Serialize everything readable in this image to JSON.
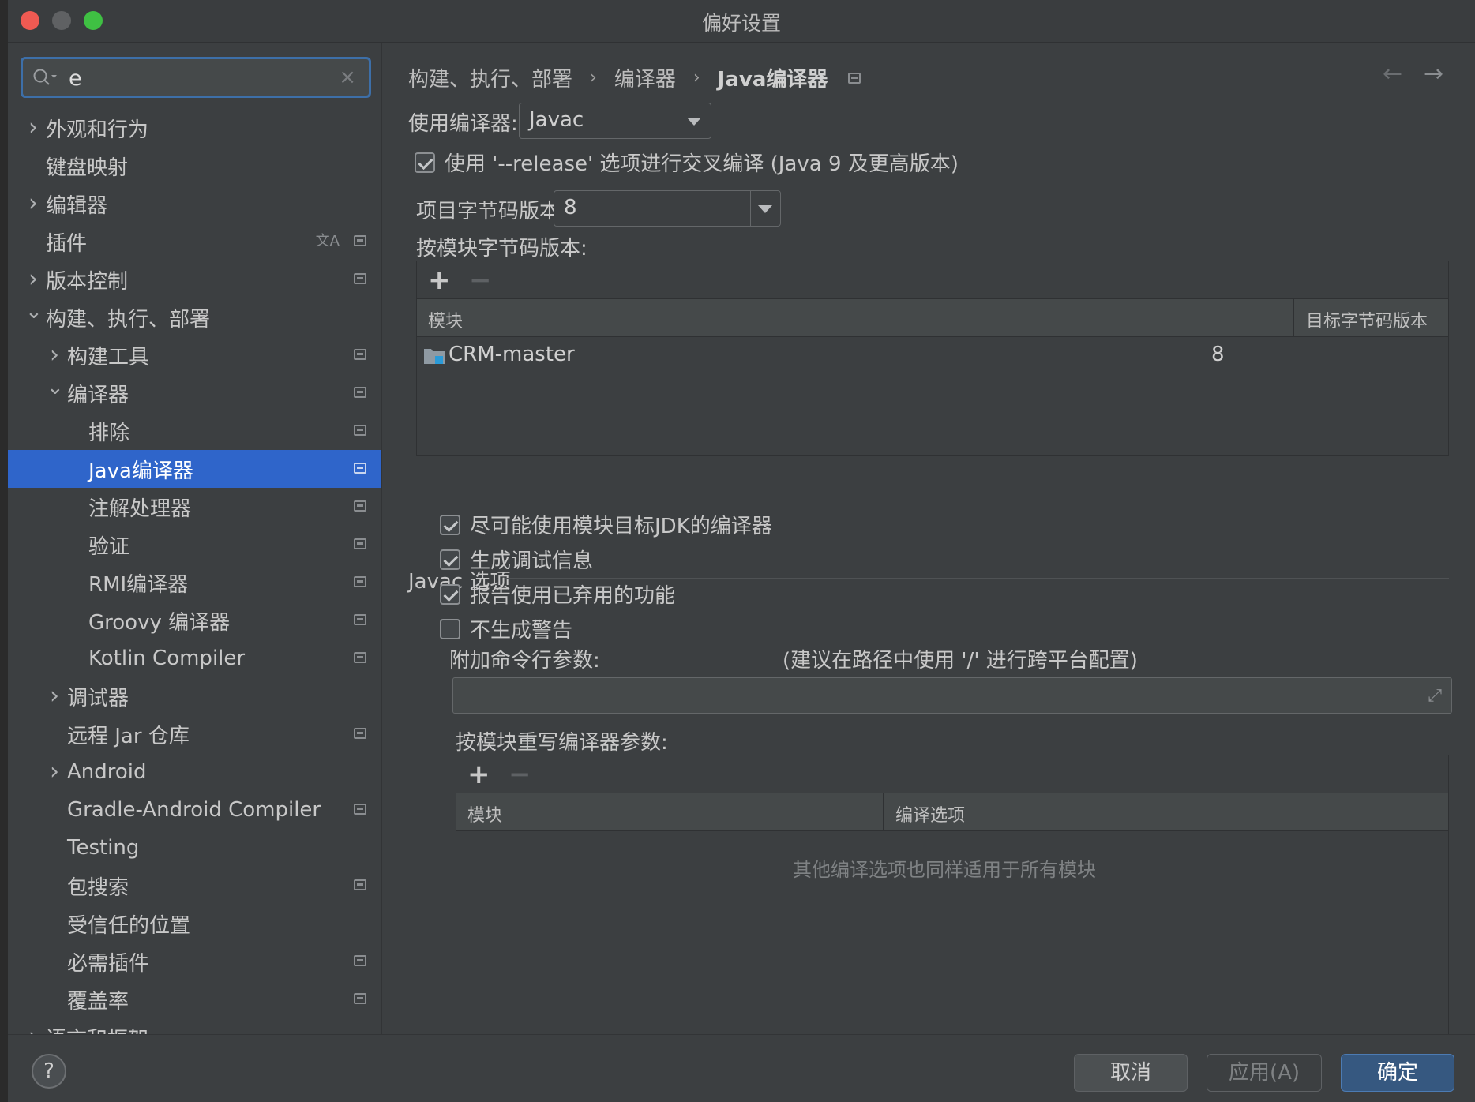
{
  "window": {
    "title": "偏好设置"
  },
  "search": {
    "value": "e",
    "clear": "×"
  },
  "sidebar": {
    "items": [
      {
        "label": "外观和行为",
        "indent": 0,
        "chevron": "right",
        "icon": false
      },
      {
        "label": "键盘映射",
        "indent": 0,
        "chevron": "none",
        "icon": false
      },
      {
        "label": "编辑器",
        "indent": 0,
        "chevron": "right",
        "icon": false
      },
      {
        "label": "插件",
        "indent": 0,
        "chevron": "none",
        "icon": true,
        "translate": true
      },
      {
        "label": "版本控制",
        "indent": 0,
        "chevron": "right",
        "icon": true
      },
      {
        "label": "构建、执行、部署",
        "indent": 0,
        "chevron": "down",
        "icon": false
      },
      {
        "label": "构建工具",
        "indent": 1,
        "chevron": "right",
        "icon": true
      },
      {
        "label": "编译器",
        "indent": 1,
        "chevron": "down",
        "icon": true
      },
      {
        "label": "排除",
        "indent": 2,
        "chevron": "none",
        "icon": true
      },
      {
        "label": "Java编译器",
        "indent": 2,
        "chevron": "none",
        "icon": true,
        "selected": true
      },
      {
        "label": "注解处理器",
        "indent": 2,
        "chevron": "none",
        "icon": true
      },
      {
        "label": "验证",
        "indent": 2,
        "chevron": "none",
        "icon": true
      },
      {
        "label": "RMI编译器",
        "indent": 2,
        "chevron": "none",
        "icon": true
      },
      {
        "label": "Groovy 编译器",
        "indent": 2,
        "chevron": "none",
        "icon": true
      },
      {
        "label": "Kotlin Compiler",
        "indent": 2,
        "chevron": "none",
        "icon": true
      },
      {
        "label": "调试器",
        "indent": 1,
        "chevron": "right",
        "icon": false
      },
      {
        "label": "远程 Jar 仓库",
        "indent": 1,
        "chevron": "none",
        "icon": true
      },
      {
        "label": "Android",
        "indent": 1,
        "chevron": "right",
        "icon": false
      },
      {
        "label": "Gradle-Android Compiler",
        "indent": 1,
        "chevron": "none",
        "icon": true
      },
      {
        "label": "Testing",
        "indent": 1,
        "chevron": "none",
        "icon": false
      },
      {
        "label": "包搜索",
        "indent": 1,
        "chevron": "none",
        "icon": true
      },
      {
        "label": "受信任的位置",
        "indent": 1,
        "chevron": "none",
        "icon": false
      },
      {
        "label": "必需插件",
        "indent": 1,
        "chevron": "none",
        "icon": true
      },
      {
        "label": "覆盖率",
        "indent": 1,
        "chevron": "none",
        "icon": true
      },
      {
        "label": "语言和框架",
        "indent": 0,
        "chevron": "right",
        "icon": false
      }
    ]
  },
  "breadcrumb": {
    "items": [
      "构建、执行、部署",
      "编译器"
    ],
    "current": "Java编译器",
    "sep": "›"
  },
  "nav": {
    "back": "←",
    "forward": "→"
  },
  "compiler": {
    "use_label": "使用编译器:",
    "use_value": "Javac",
    "release_option": {
      "label": "使用 '--release' 选项进行交叉编译 (Java 9 及更高版本)",
      "checked": true
    },
    "bytecode_label": "项目字节码版本:",
    "bytecode_value": "8",
    "per_module_label": "按模块字节码版本:",
    "module_table": {
      "add": "+",
      "remove": "−",
      "headers": [
        "模块",
        "目标字节码版本"
      ],
      "rows": [
        {
          "module": "CRM-master",
          "target": "8"
        }
      ]
    }
  },
  "javac": {
    "section_title": "Javac 选项",
    "options": [
      {
        "label": "尽可能使用模块目标JDK的编译器",
        "checked": true
      },
      {
        "label": "生成调试信息",
        "checked": true
      },
      {
        "label": "报告使用已弃用的功能",
        "checked": true
      },
      {
        "label": "不生成警告",
        "checked": false
      }
    ],
    "cmd_label": "附加命令行参数:",
    "cmd_hint": "(建议在路径中使用 '/' 进行跨平台配置)",
    "cmd_value": "",
    "override_label": "按模块重写编译器参数:",
    "override_table": {
      "add": "+",
      "remove": "−",
      "headers": [
        "模块",
        "编译选项"
      ],
      "empty": "其他编译选项也同样适用于所有模块"
    }
  },
  "footer": {
    "help": "?",
    "cancel": "取消",
    "apply": "应用(A)",
    "ok": "确定"
  },
  "colors": {
    "selection": "#2f65ca",
    "ok_button": "#365880",
    "focus_ring": "#3d6fa8"
  }
}
